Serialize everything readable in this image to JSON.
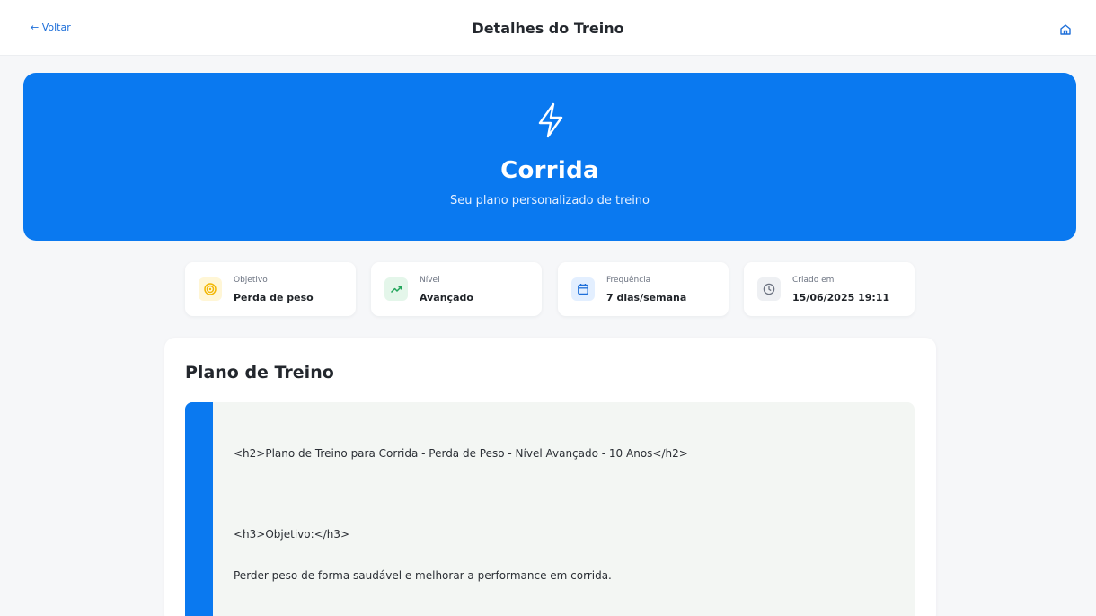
{
  "header": {
    "back_label": "← Voltar",
    "title": "Detalhes do Treino",
    "home_icon": "home-icon"
  },
  "hero": {
    "icon": "lightning-icon",
    "title": "Corrida",
    "subtitle": "Seu plano personalizado de treino",
    "background": "#0a79f0"
  },
  "stats": [
    {
      "label": "Objetivo",
      "value": "Perda de peso",
      "icon": "target-icon",
      "icon_bg": "#fff6d6",
      "icon_color": "#f2b705"
    },
    {
      "label": "Nível",
      "value": "Avançado",
      "icon": "trending-up-icon",
      "icon_bg": "#e4f6ea",
      "icon_color": "#22a55b"
    },
    {
      "label": "Frequência",
      "value": "7 dias/semana",
      "icon": "calendar-icon",
      "icon_bg": "#e3efff",
      "icon_color": "#1e6fd9"
    },
    {
      "label": "Criado em",
      "value": "15/06/2025 19:11",
      "icon": "clock-icon",
      "icon_bg": "#eef0f3",
      "icon_color": "#6b7280"
    }
  ],
  "plan": {
    "title": "Plano de Treino",
    "lines": [
      "<h2>Plano de Treino para Corrida - Perda de Peso - Nível Avançado - 10 Anos</h2>",
      "<h3>Objetivo:</h3>",
      "Perder peso de forma saudável e melhorar a performance em corrida."
    ]
  }
}
